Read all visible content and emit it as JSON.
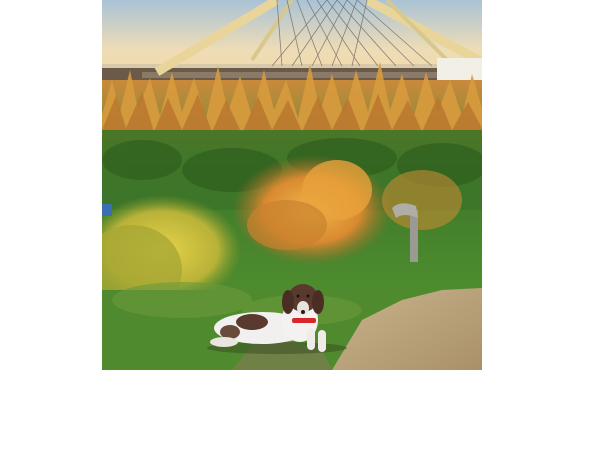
{
  "image": {
    "subject": "dog-lying-on-grass",
    "colors": {
      "sky_top": "#a9c3d6",
      "sky_bottom": "#f3d9a6",
      "bridge": "#e9d59a",
      "grass_tall": "#d89a3e",
      "grass_green": "#4d8b2e",
      "shrub": "#d9a03a",
      "ground": "#b7a37f",
      "dog_white": "#f2f0ee",
      "dog_brown": "#5a3a2e",
      "collar": "#d9262b"
    }
  }
}
